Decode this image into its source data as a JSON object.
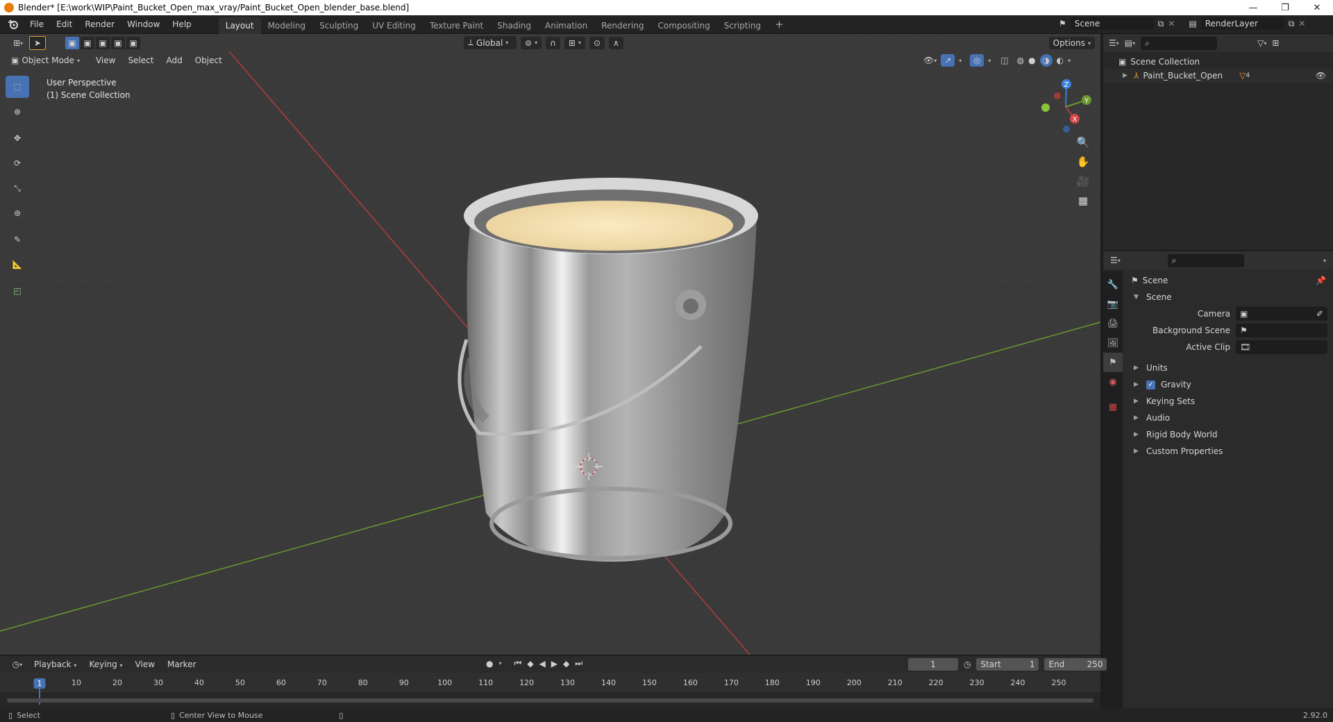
{
  "window": {
    "title": "Blender* [E:\\work\\WIP\\Paint_Bucket_Open_max_vray/Paint_Bucket_Open_blender_base.blend]",
    "controls": [
      "—",
      "❐",
      "✕"
    ]
  },
  "menubar": {
    "menus": [
      "File",
      "Edit",
      "Render",
      "Window",
      "Help"
    ],
    "workspaces": [
      "Layout",
      "Modeling",
      "Sculpting",
      "UV Editing",
      "Texture Paint",
      "Shading",
      "Animation",
      "Rendering",
      "Compositing",
      "Scripting"
    ],
    "active_workspace": "Layout",
    "add_tab": "+",
    "scene_name": "Scene",
    "render_layer": "RenderLayer"
  },
  "viewport": {
    "mode": "Object Mode",
    "menus": [
      "View",
      "Select",
      "Add",
      "Object"
    ],
    "transform_orientation": "Global",
    "options_label": "Options",
    "overlay_line1": "User Perspective",
    "overlay_line2": "(1) Scene Collection",
    "gizmo_axes": [
      "Z",
      "Y",
      "X"
    ]
  },
  "outliner": {
    "root": "Scene Collection",
    "items": [
      {
        "name": "Paint_Bucket_Open",
        "count": "4"
      }
    ]
  },
  "properties": {
    "context": "Scene",
    "section": "Scene",
    "fields": [
      {
        "label": "Camera",
        "value": ""
      },
      {
        "label": "Background Scene",
        "value": ""
      },
      {
        "label": "Active Clip",
        "value": ""
      }
    ],
    "panels": [
      {
        "label": "Units",
        "checkbox": false
      },
      {
        "label": "Gravity",
        "checkbox": true
      },
      {
        "label": "Keying Sets",
        "checkbox": false
      },
      {
        "label": "Audio",
        "checkbox": false
      },
      {
        "label": "Rigid Body World",
        "checkbox": false
      },
      {
        "label": "Custom Properties",
        "checkbox": false
      }
    ]
  },
  "timeline": {
    "menus": [
      "Playback",
      "Keying",
      "View",
      "Marker"
    ],
    "current_frame": "1",
    "start_label": "Start",
    "start_value": "1",
    "end_label": "End",
    "end_value": "250",
    "ticks": [
      "1",
      "10",
      "20",
      "30",
      "40",
      "50",
      "60",
      "70",
      "80",
      "90",
      "100",
      "110",
      "120",
      "130",
      "140",
      "150",
      "160",
      "170",
      "180",
      "190",
      "200",
      "210",
      "220",
      "230",
      "240",
      "250"
    ],
    "tick_values": [
      1,
      10,
      20,
      30,
      40,
      50,
      60,
      70,
      80,
      90,
      100,
      110,
      120,
      130,
      140,
      150,
      160,
      170,
      180,
      190,
      200,
      210,
      220,
      230,
      240,
      250
    ]
  },
  "statusbar": {
    "left_action": "Select",
    "middle_action": "Center View to Mouse",
    "version": "2.92.0"
  },
  "colors": {
    "accent": "#4772b3",
    "x_axis": "#b43c3c",
    "y_axis": "#6b9a2e",
    "z_axis": "#3f7fd6",
    "paint": "#f6e4b8"
  }
}
